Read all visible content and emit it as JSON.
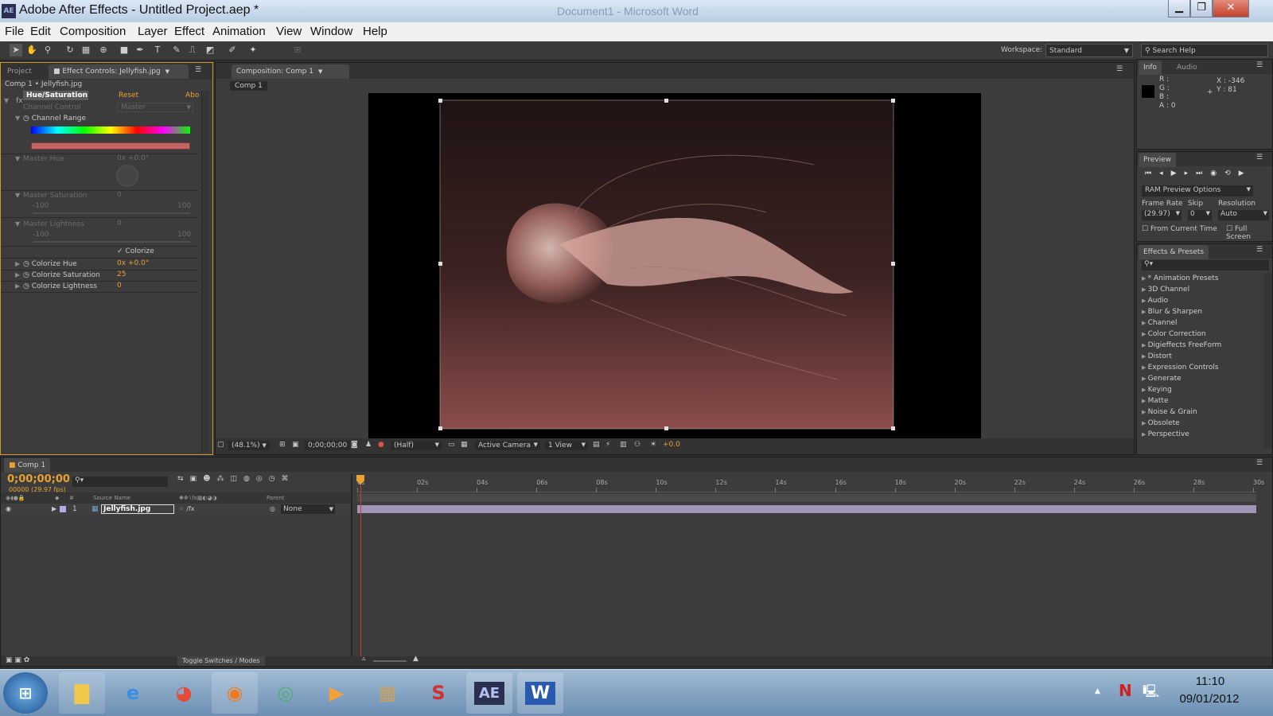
{
  "window": {
    "app_icon": "AE",
    "title": "Adobe After Effects - Untitled Project.aep *",
    "ghost_title": "Document1 - Microsoft Word",
    "controls": [
      "minimize-icon",
      "restore-icon",
      "close-icon"
    ]
  },
  "menu": [
    "File",
    "Edit",
    "Composition",
    "Layer",
    "Effect",
    "Animation",
    "View",
    "Window",
    "Help"
  ],
  "toolbar": {
    "workspace_label": "Workspace:",
    "workspace_value": "Standard",
    "search_placeholder": "Search Help"
  },
  "left_panel": {
    "tab_project": "Project",
    "tab_effect_controls": "Effect Controls: Jellyfish.jpg",
    "breadcrumb": "Comp 1 • Jellyfish.jpg",
    "effect_name": "Hue/Saturation",
    "reset_label": "Reset",
    "about_label": "Abo",
    "channel_control_label": "Channel Control",
    "channel_control_value": "Master",
    "channel_range_label": "Channel Range",
    "master_hue_label": "Master Hue",
    "master_hue_value": "0x +0.0°",
    "master_saturation_label": "Master Saturation",
    "master_saturation_value": "0",
    "master_lightness_label": "Master Lightness",
    "master_lightness_value": "0",
    "slider_min": "-100",
    "slider_max": "100",
    "colorize_label": "Colorize",
    "colorize_hue_label": "Colorize Hue",
    "colorize_hue_value": "0x +0.0°",
    "colorize_saturation_label": "Colorize Saturation",
    "colorize_saturation_value": "25",
    "colorize_lightness_label": "Colorize Lightness",
    "colorize_lightness_value": "0"
  },
  "composition": {
    "tab": "Composition: Comp 1",
    "sub_tab": "Comp 1",
    "zoom": "(48.1%)",
    "timecode": "0;00;00;00",
    "resolution": "(Half)",
    "camera": "Active Camera",
    "views": "1 View",
    "exposure": "+0.0"
  },
  "info": {
    "tab_info": "Info",
    "tab_audio": "Audio",
    "r": "R :",
    "g": "G :",
    "b": "B :",
    "a": "A : 0",
    "x": "X : -346",
    "y": "Y : 81"
  },
  "preview": {
    "tab": "Preview",
    "options": "RAM Preview Options",
    "frame_rate_label": "Frame Rate",
    "skip_label": "Skip",
    "resolution_label": "Resolution",
    "frame_rate_value": "(29.97)",
    "skip_value": "0",
    "resolution_value": "Auto",
    "from_current": "From Current Time",
    "full_screen": "Full Screen"
  },
  "effects_presets": {
    "tab": "Effects & Presets",
    "items": [
      "* Animation Presets",
      "3D Channel",
      "Audio",
      "Blur & Sharpen",
      "Channel",
      "Color Correction",
      "Digieffects FreeForm",
      "Distort",
      "Expression Controls",
      "Generate",
      "Keying",
      "Matte",
      "Noise & Grain",
      "Obsolete",
      "Perspective"
    ]
  },
  "timeline": {
    "tab": "Comp 1",
    "timecode": "0;00;00;00",
    "fps": "00000 (29.97 fps)",
    "col_source": "Source Name",
    "col_parent": "Parent",
    "layer_index": "1",
    "layer_name": "Jellyfish.jpg",
    "parent_value": "None",
    "toggle": "Toggle Switches / Modes",
    "ruler": [
      "0s",
      "02s",
      "04s",
      "06s",
      "08s",
      "10s",
      "12s",
      "14s",
      "16s",
      "18s",
      "20s",
      "22s",
      "24s",
      "26s",
      "28s",
      "30s"
    ]
  },
  "taskbar": {
    "apps": [
      "windows-start-icon",
      "file-explorer-icon",
      "internet-explorer-icon",
      "chrome-icon",
      "firefox-icon",
      "app-icon",
      "media-player-icon",
      "photos-icon",
      "sbp-icon",
      "after-effects-icon",
      "word-icon"
    ],
    "ae_label": "AE",
    "word_label": "W",
    "time": "11:10",
    "date": "09/01/2012"
  },
  "colors": {
    "panel": "#3c3c3c",
    "accent": "#e8a230",
    "taskbar": "#7b9bbd",
    "jelly_bg": "#5a3232"
  }
}
